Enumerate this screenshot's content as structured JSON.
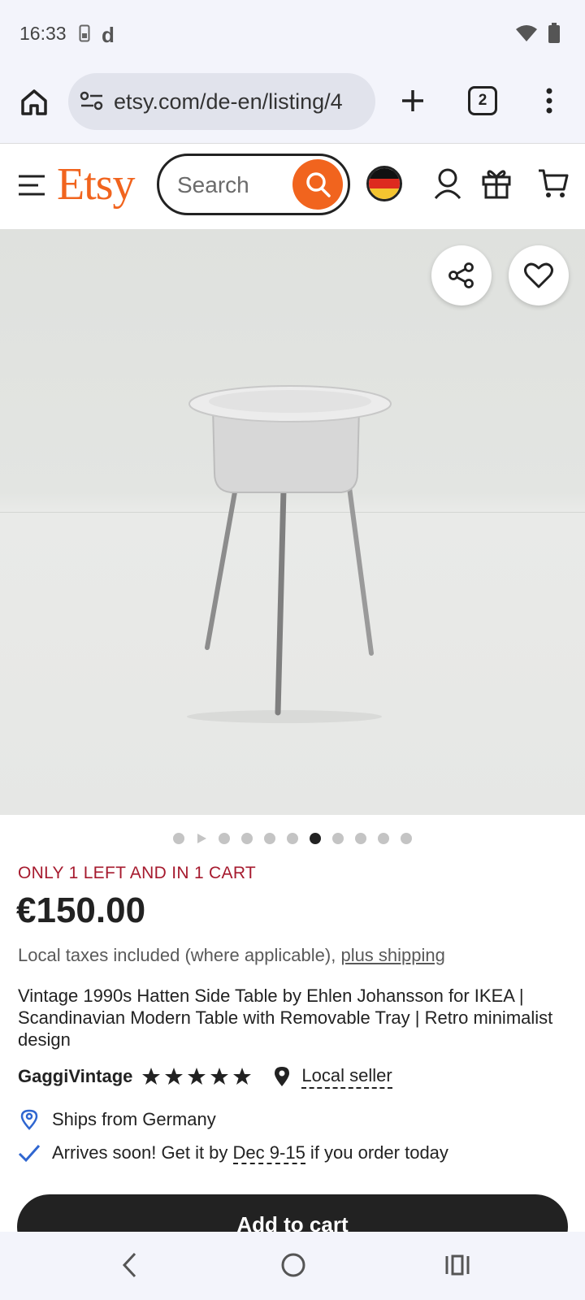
{
  "status_bar": {
    "time": "16:33",
    "left_icons": [
      "phone-storage-icon",
      "d-app-icon"
    ],
    "d_glyph": "d",
    "right_icons": [
      "wifi-icon",
      "battery-icon"
    ]
  },
  "browser": {
    "url": "etsy.com/de-en/listing/4",
    "tab_count": "2",
    "icons": [
      "home-icon",
      "site-settings-icon",
      "new-tab-icon",
      "tab-switcher-icon",
      "more-vert-icon"
    ]
  },
  "header": {
    "logo": "Etsy",
    "search_placeholder": "Search",
    "icons": [
      "menu-icon",
      "search-icon",
      "germany-flag-icon",
      "account-icon",
      "gift-icon",
      "cart-icon"
    ]
  },
  "product_image": {
    "actions": [
      "share-icon",
      "heart-icon"
    ],
    "carousel_dots": 11,
    "active_dot": 7
  },
  "listing": {
    "stock_note": "ONLY 1 LEFT AND IN 1 CART",
    "price": "€150.00",
    "tax_prefix": "Local taxes included (where applicable), ",
    "tax_link": "plus shipping",
    "title": "Vintage 1990s Hatten Side Table by Ehlen Johansson for IKEA | Scandinavian Modern Table with Removable Tray | Retro minimalist design",
    "seller": "GaggiVintage",
    "rating_stars": 5,
    "local_seller": "Local seller",
    "ships_from": "Ships from Germany",
    "arrives_prefix": "Arrives soon! Get it by ",
    "arrives_date": "Dec 9-15",
    "arrives_suffix": " if you order today",
    "add_to_cart": "Add to cart"
  },
  "colors": {
    "brand": "#f1641e",
    "stock_note": "#a61a2e",
    "ship_pin": "#2f66d0",
    "check": "#2f66d0"
  }
}
